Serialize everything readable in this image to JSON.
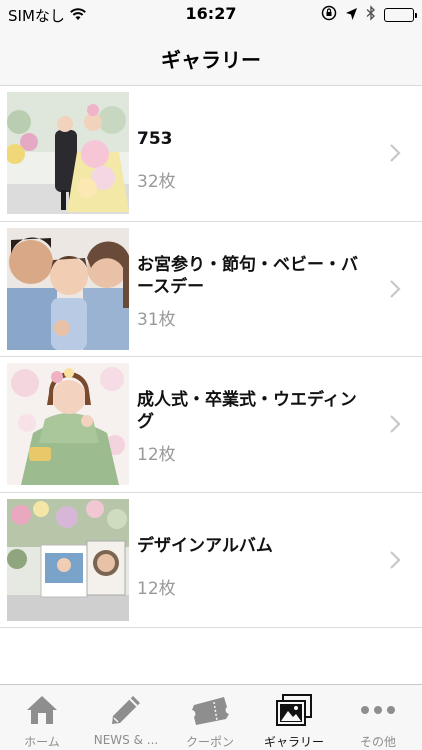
{
  "status_bar": {
    "carrier": "SIMなし",
    "time": "16:27",
    "icons": [
      "wifi-icon",
      "orientation-lock-icon",
      "location-arrow-icon",
      "bluetooth-icon",
      "battery-icon"
    ]
  },
  "nav": {
    "title": "ギャラリー"
  },
  "gallery": [
    {
      "name": "753",
      "count": "32枚",
      "thumb_icon": "photo-753-thumbnail"
    },
    {
      "name": "お宮参り・節句・ベビー・バースデー",
      "name_line1": "お宮参り・節句・ベビー・バ",
      "name_line2": "ースデー",
      "count": "31枚",
      "thumb_icon": "photo-baby-thumbnail"
    },
    {
      "name": "成人式・卒業式・ウエディング",
      "name_line1": "成人式・卒業式・ウエディン",
      "name_line2": "グ",
      "count": "12枚",
      "thumb_icon": "photo-kimono-thumbnail"
    },
    {
      "name": "デザインアルバム",
      "count": "12枚",
      "thumb_icon": "photo-album-thumbnail"
    }
  ],
  "tab_bar": {
    "items": [
      {
        "label": "ホーム",
        "icon": "home-icon",
        "active": false
      },
      {
        "label": "NEWS & ...",
        "icon": "pencil-icon",
        "active": false
      },
      {
        "label": "クーポン",
        "icon": "ticket-icon",
        "active": false
      },
      {
        "label": "ギャラリー",
        "icon": "gallery-icon",
        "active": true
      },
      {
        "label": "その他",
        "icon": "more-icon",
        "active": false
      }
    ]
  },
  "colors": {
    "bar_background": "#f7f7f7",
    "count_gray": "#9a9a9a",
    "tab_inactive": "#8e8e8e",
    "tab_active": "#111111",
    "chevron": "#c7c7cc"
  }
}
